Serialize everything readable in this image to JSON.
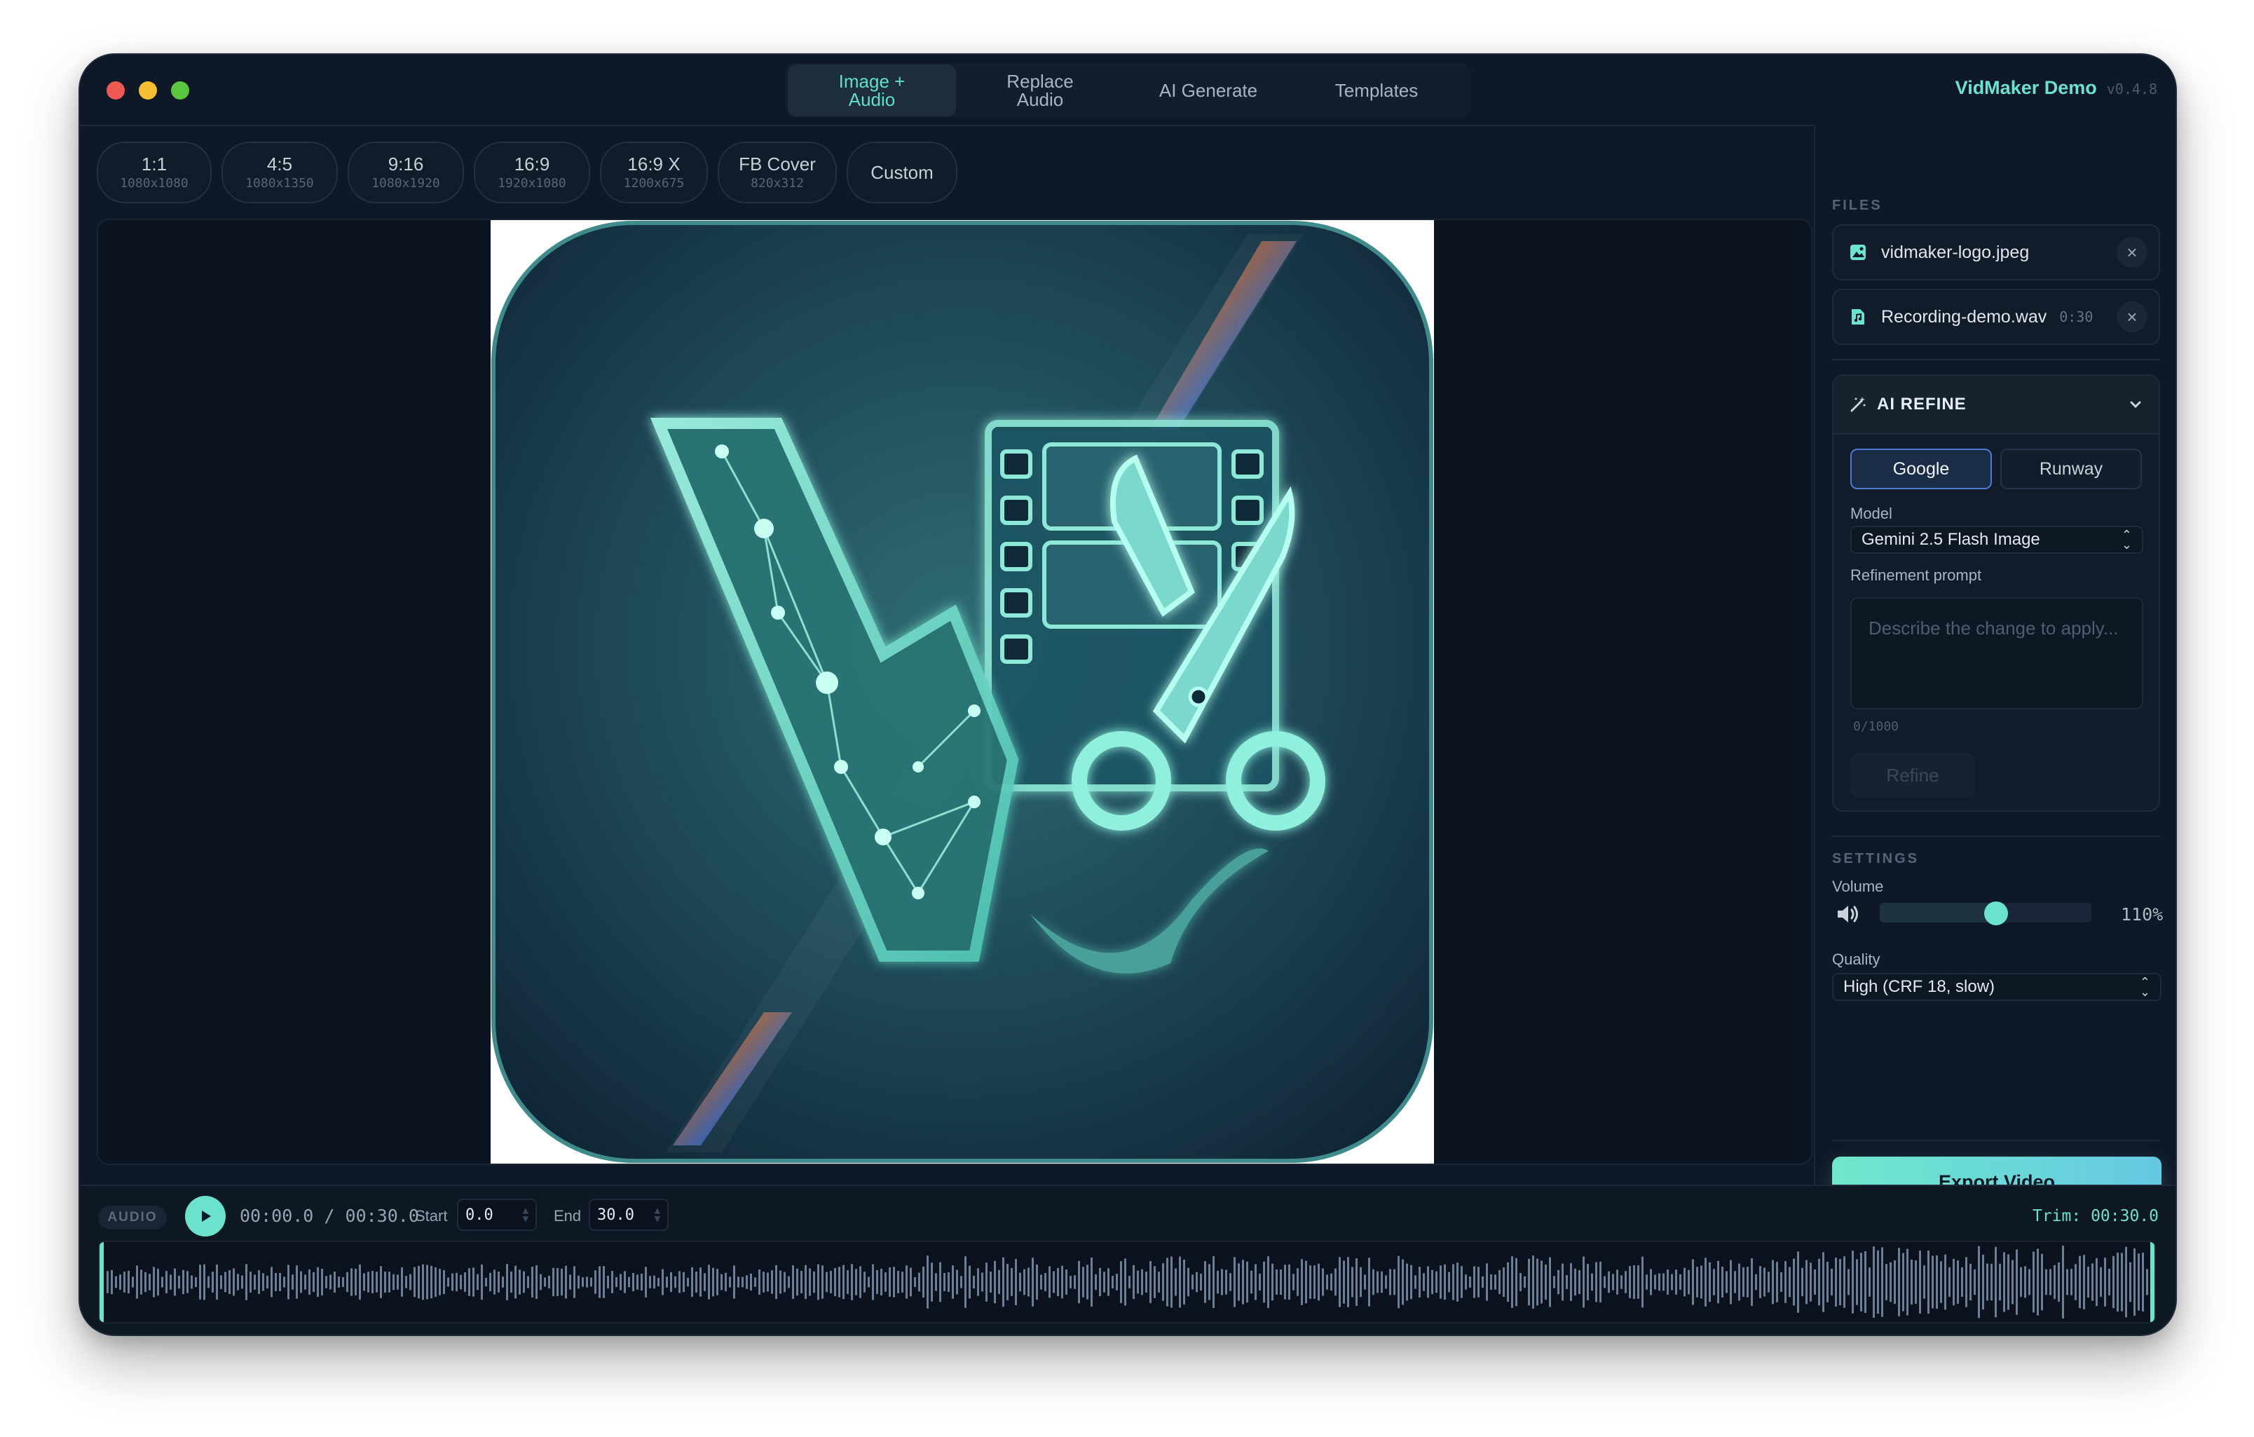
{
  "mode_tabs": [
    {
      "label": "Image +\nAudio",
      "active": true
    },
    {
      "label": "Replace\nAudio",
      "active": false
    },
    {
      "label": "AI Generate",
      "active": false
    },
    {
      "label": "Templates",
      "active": false
    }
  ],
  "brand": {
    "name": "VidMaker Demo",
    "version": "v0.4.8"
  },
  "ratios": [
    {
      "label": "1:1",
      "size": "1080x1080"
    },
    {
      "label": "4:5",
      "size": "1080x1350"
    },
    {
      "label": "9:16",
      "size": "1080x1920"
    },
    {
      "label": "16:9",
      "size": "1920x1080"
    },
    {
      "label": "16:9 X",
      "size": "1200x675"
    },
    {
      "label": "FB Cover",
      "size": "820x312"
    },
    {
      "label": "Custom",
      "size": ""
    }
  ],
  "files": {
    "header": "FILES",
    "items": [
      {
        "name": "vidmaker-logo.jpeg",
        "duration": "",
        "icon": "image-file-icon"
      },
      {
        "name": "Recording-demo.wav",
        "duration": "0:30",
        "icon": "audio-file-icon"
      }
    ]
  },
  "ai_refine": {
    "title": "AI REFINE",
    "providers": [
      "Google",
      "Runway"
    ],
    "active_provider": "Google",
    "model_label": "Model",
    "model_value": "Gemini 2.5 Flash Image",
    "prompt_label": "Refinement prompt",
    "prompt_placeholder": "Describe the change to apply...",
    "counter": "0/1000",
    "button": "Refine"
  },
  "settings": {
    "header": "SETTINGS",
    "volume_label": "Volume",
    "volume_value": "110%",
    "volume_level": 0.55,
    "quality_label": "Quality",
    "quality_value": "High (CRF 18, slow)"
  },
  "export_button": "Export Video",
  "audio": {
    "tag": "AUDIO",
    "time": "00:00.0 / 00:30.0",
    "start_label": "Start",
    "start_value": "0.0",
    "end_label": "End",
    "end_value": "30.0",
    "trim": "Trim: 00:30.0"
  },
  "colors": {
    "accent": "#6be3cc",
    "background": "#0f1826",
    "primary_blue": "#4d7bd3"
  }
}
